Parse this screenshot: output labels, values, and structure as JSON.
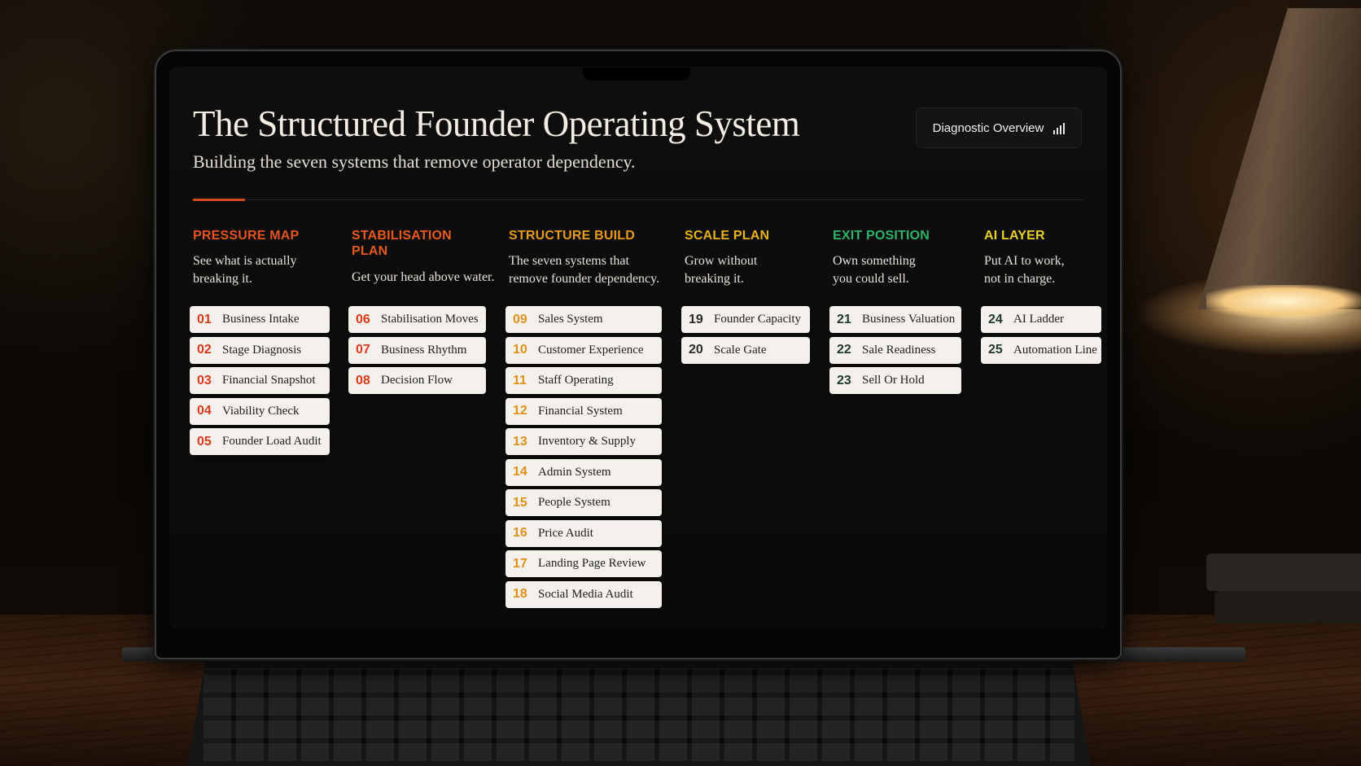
{
  "header": {
    "title": "The Structured Founder Operating System",
    "subtitle": "Building the seven systems that remove operator dependency.",
    "overview_button": "Diagnostic Overview",
    "overview_icon": "bar-chart-icon"
  },
  "columns": [
    {
      "heading": "PRESSURE MAP",
      "color": "#e3541f",
      "desc1": "See what is actually",
      "desc2": "breaking it.",
      "items": [
        {
          "num": "01",
          "label": "Business Intake"
        },
        {
          "num": "02",
          "label": "Stage Diagnosis"
        },
        {
          "num": "03",
          "label": "Financial Snapshot"
        },
        {
          "num": "04",
          "label": "Viability Check"
        },
        {
          "num": "05",
          "label": "Founder Load Audit"
        }
      ]
    },
    {
      "heading1": "STABILISATION",
      "heading2": "PLAN",
      "color": "#e85a1e",
      "desc1": "Get your head above water.",
      "items": [
        {
          "num": "06",
          "label": "Stabilisation Moves"
        },
        {
          "num": "07",
          "label": "Business Rhythm"
        },
        {
          "num": "08",
          "label": "Decision Flow"
        }
      ]
    },
    {
      "heading": "STRUCTURE BUILD",
      "color": "#e79a1c",
      "desc1": "The seven systems that",
      "desc2": "remove founder dependency.",
      "items": [
        {
          "num": "09",
          "label": "Sales System"
        },
        {
          "num": "10",
          "label": "Customer Experience"
        },
        {
          "num": "11",
          "label": "Staff Operating"
        },
        {
          "num": "12",
          "label": "Financial System"
        },
        {
          "num": "13",
          "label": "Inventory & Supply"
        },
        {
          "num": "14",
          "label": "Admin System"
        },
        {
          "num": "15",
          "label": "People System"
        },
        {
          "num": "16",
          "label": "Price Audit"
        },
        {
          "num": "17",
          "label": "Landing Page Review"
        },
        {
          "num": "18",
          "label": "Social Media Audit"
        }
      ]
    },
    {
      "heading": "SCALE PLAN",
      "color": "#e8b21c",
      "num_color": "#2a2a2a",
      "desc1": "Grow without",
      "desc2": "breaking it.",
      "items": [
        {
          "num": "19",
          "label": "Founder Capacity"
        },
        {
          "num": "20",
          "label": "Scale Gate"
        }
      ]
    },
    {
      "heading": "EXIT POSITION",
      "color": "#2fb36a",
      "num_color": "#1f3a2a",
      "desc1": "Own something",
      "desc2": "you could sell.",
      "items": [
        {
          "num": "21",
          "label": "Business Valuation"
        },
        {
          "num": "22",
          "label": "Sale Readiness"
        },
        {
          "num": "23",
          "label": "Sell Or Hold"
        }
      ]
    },
    {
      "heading": "AI LAYER",
      "color": "#e9d02a",
      "num_color": "#1f3a2a",
      "desc1": "Put AI to work,",
      "desc2": "not in charge.",
      "items": [
        {
          "num": "24",
          "label": "AI Ladder"
        },
        {
          "num": "25",
          "label": "Automation Line"
        }
      ]
    }
  ]
}
